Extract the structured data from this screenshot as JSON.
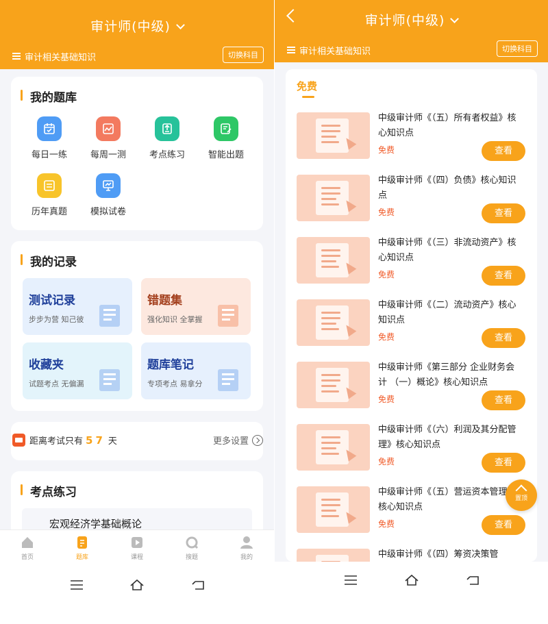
{
  "colors": {
    "accent": "#f8a31b",
    "free": "#f05a28"
  },
  "left": {
    "header_title": "审计师(中级)",
    "subject": "审计相关基础知识",
    "switch_label": "切换科目",
    "bank": {
      "title": "我的题库",
      "items": [
        {
          "label": "每日一练",
          "icon": "calendar-icon",
          "color": "#4f9cf5"
        },
        {
          "label": "每周一测",
          "icon": "chart-icon",
          "color": "#f37a5f"
        },
        {
          "label": "考点练习",
          "icon": "practice-icon",
          "color": "#27c29a"
        },
        {
          "label": "智能出题",
          "icon": "smart-edit-icon",
          "color": "#2ec766"
        },
        {
          "label": "历年真题",
          "icon": "exam-paper-icon",
          "color": "#f8c42a"
        },
        {
          "label": "模拟试卷",
          "icon": "presentation-icon",
          "color": "#4f9cf5"
        }
      ]
    },
    "records": {
      "title": "我的记录",
      "items": [
        {
          "title": "测试记录",
          "sub": "步步为营 知己彼",
          "bg": "#e6f0fd",
          "color": "#1f3f9a"
        },
        {
          "title": "错题集",
          "sub": "强化知识 全掌握",
          "bg": "#fde8df",
          "color": "#a4401e"
        },
        {
          "title": "收藏夹",
          "sub": "试题考点 无偏漏",
          "bg": "#e3f4fb",
          "color": "#1f3f9a"
        },
        {
          "title": "题库笔记",
          "sub": "专项考点 易拿分",
          "bg": "#e6f0fd",
          "color": "#1f3f9a"
        }
      ]
    },
    "countdown": {
      "prefix": "距离考试只有",
      "days": "57",
      "suffix": "天",
      "more": "更多设置"
    },
    "practice": {
      "title": "考点练习",
      "first_topic": "宏观经济学基础概论"
    },
    "tabs": [
      {
        "label": "首页",
        "icon": "home-icon"
      },
      {
        "label": "题库",
        "icon": "question-bank-icon",
        "active": true
      },
      {
        "label": "课程",
        "icon": "course-play-icon"
      },
      {
        "label": "搜题",
        "icon": "search-question-icon"
      },
      {
        "label": "我的",
        "icon": "profile-icon"
      }
    ]
  },
  "right": {
    "header_title": "审计师(中级)",
    "subject": "审计相关基础知识",
    "switch_label": "切换科目",
    "filter_tab": "免费",
    "view_label": "查看",
    "free_label": "免费",
    "back_to_top": "置顶",
    "items": [
      {
        "title": "中级审计师《（五）所有者权益》核心知识点"
      },
      {
        "title": "中级审计师《（四）负债》核心知识点"
      },
      {
        "title": "中级审计师《（三）非流动资产》核心知识点"
      },
      {
        "title": "中级审计师《（二）流动资产》核心知识点"
      },
      {
        "title": "中级审计师《第三部分 企业财务会计 （一）概论》核心知识点"
      },
      {
        "title": "中级审计师《（六）利润及其分配管理》核心知识点"
      },
      {
        "title": "中级审计师《（五）营运资本管理》核心知识点"
      },
      {
        "title": "中级审计师《（四）筹资决策管"
      }
    ]
  }
}
